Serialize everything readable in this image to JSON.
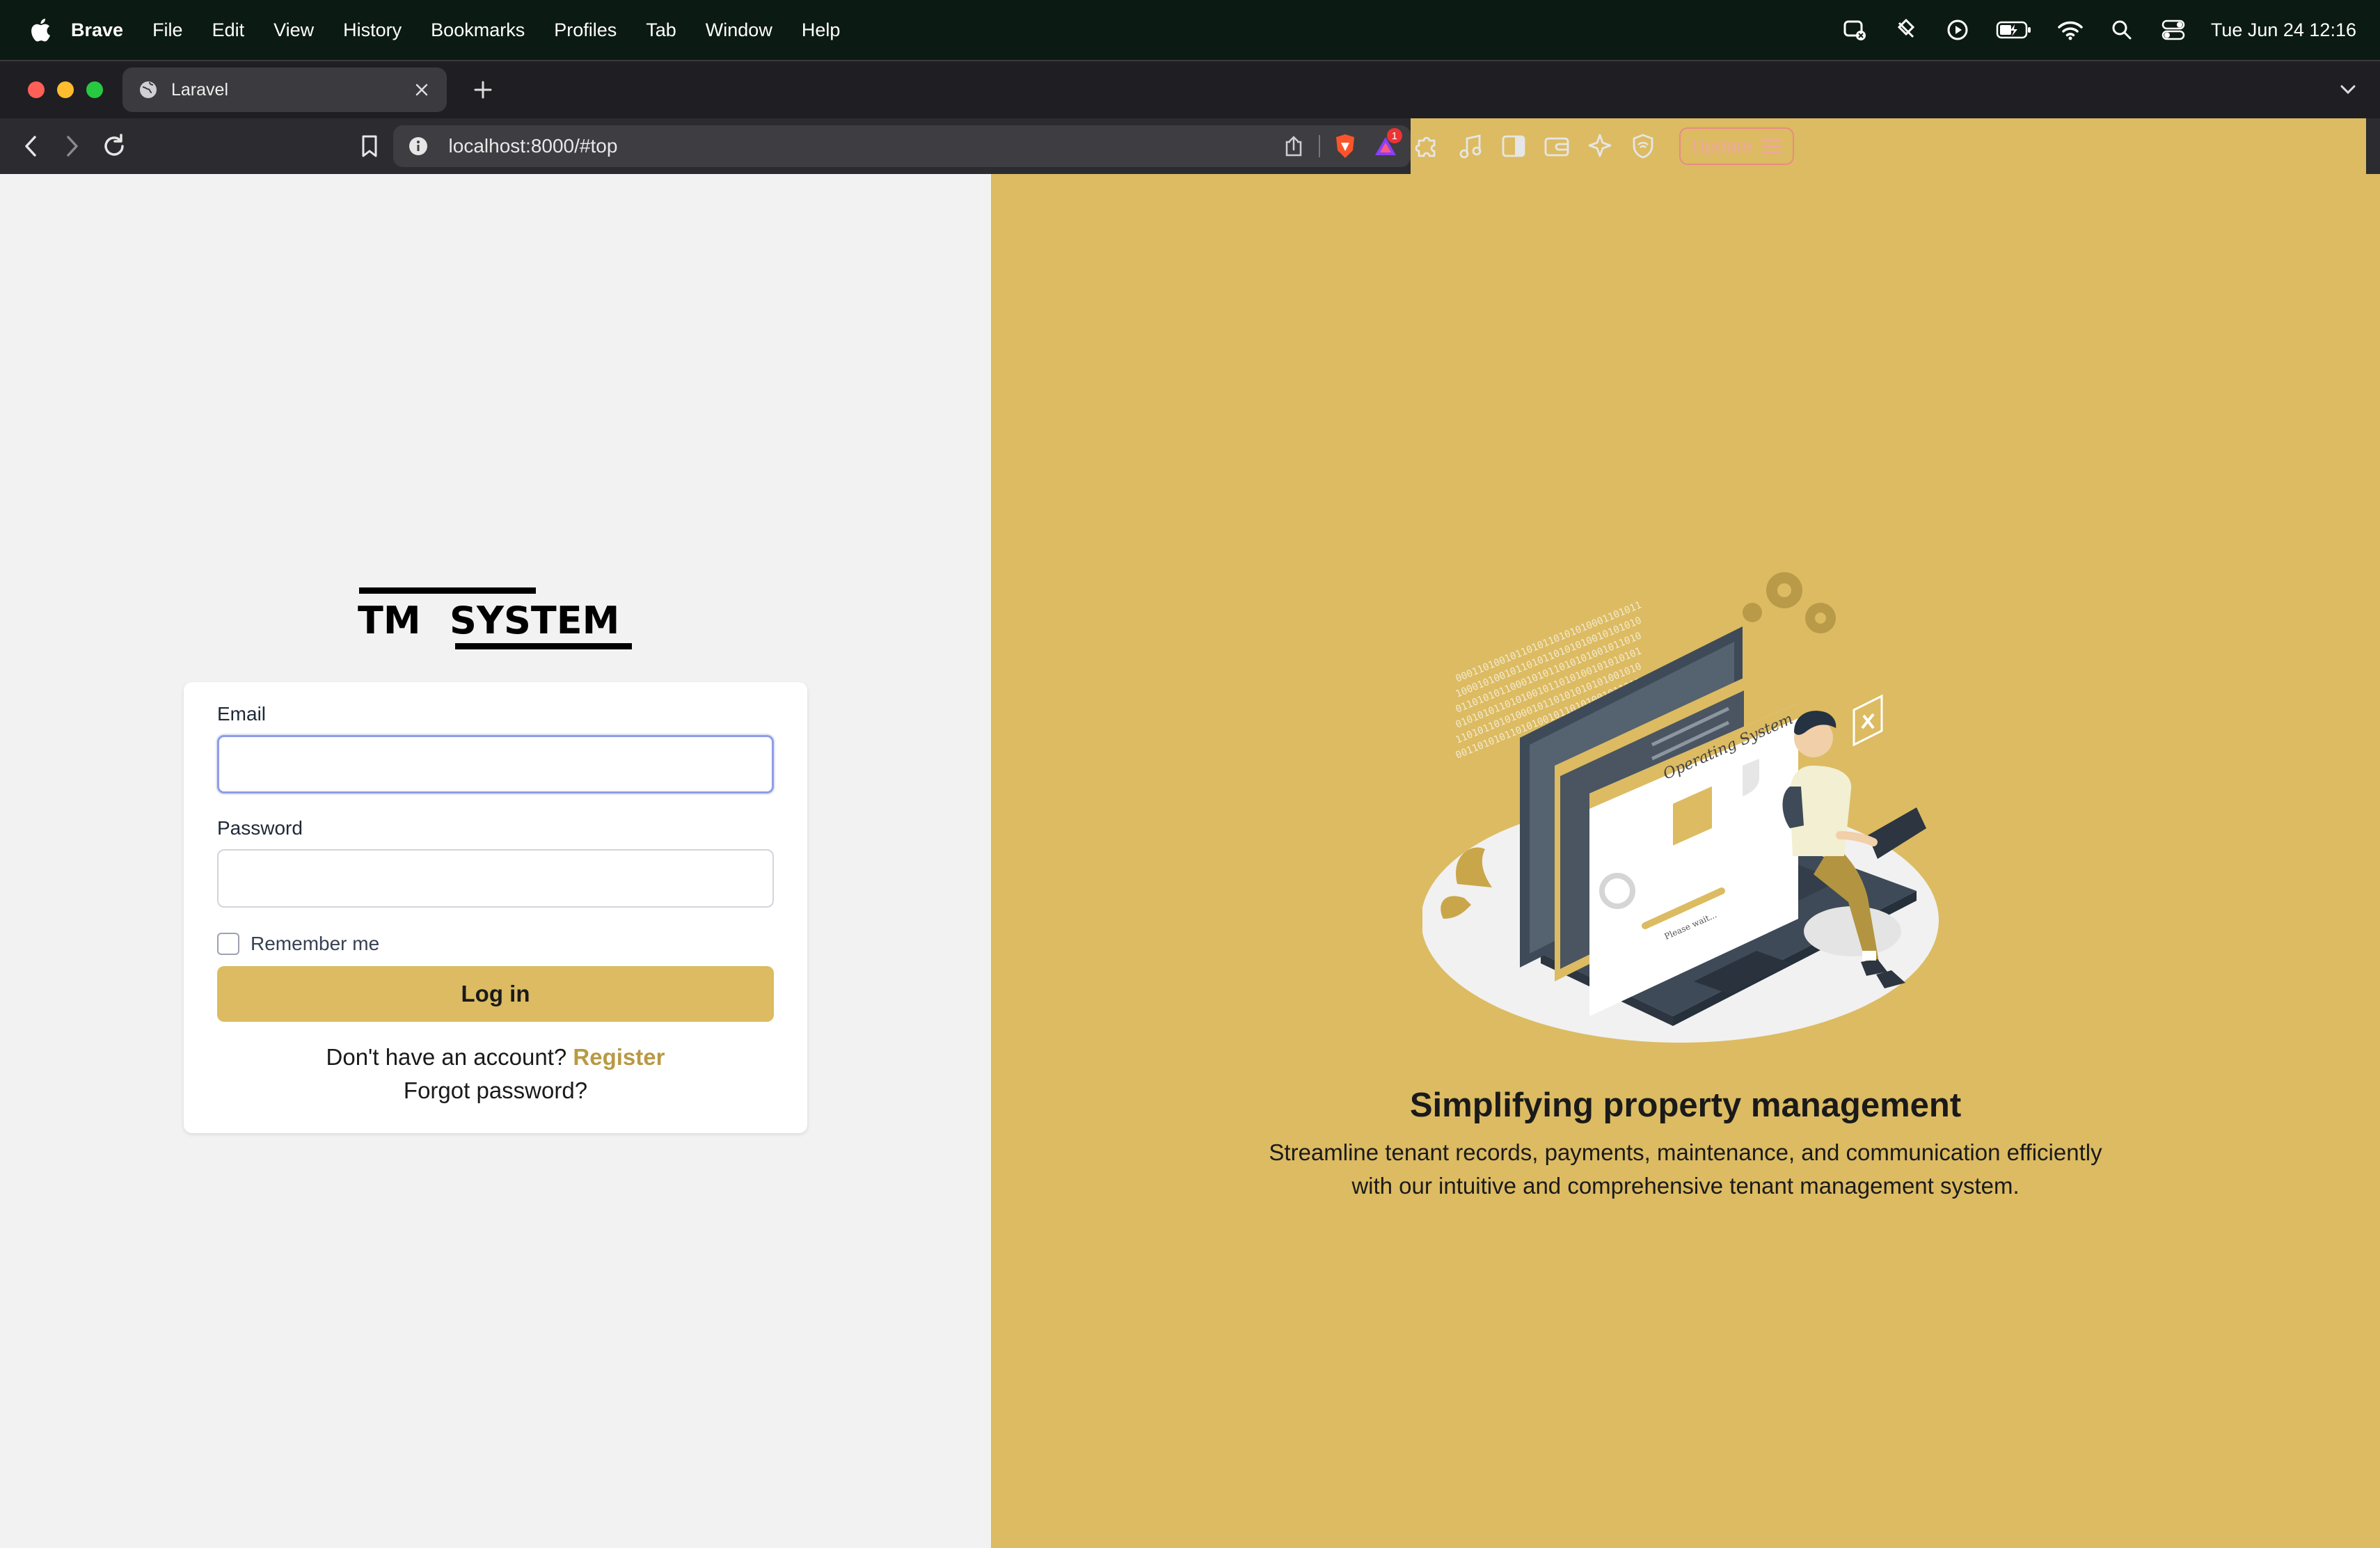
{
  "menubar": {
    "app_name": "Brave",
    "items": [
      "File",
      "Edit",
      "View",
      "History",
      "Bookmarks",
      "Profiles",
      "Tab",
      "Window",
      "Help"
    ],
    "status_icons": [
      "screen-record-icon",
      "brave-vpn-icon",
      "play-icon",
      "battery-icon",
      "wifi-icon",
      "spotlight-search-icon",
      "control-center-icon"
    ],
    "clock": "Tue Jun 24  12:16"
  },
  "browser": {
    "tab_title": "Laravel",
    "url": "localhost:8000/#top",
    "update_label": "Update",
    "rewards_badge": "1",
    "colors": {
      "tabstrip": "#1f1f23",
      "toolbar": "#2b2b30",
      "urlbar": "#3d3d42"
    }
  },
  "login": {
    "logo_text_left": "TM",
    "logo_text_right": "SYSTEM",
    "email_label": "Email",
    "email_value": "",
    "password_label": "Password",
    "password_value": "",
    "remember_label": "Remember me",
    "remember_checked": false,
    "login_button": "Log in",
    "no_account_text": "Don't have an account?",
    "register_link": "Register",
    "forgot_link": "Forgot password?"
  },
  "hero": {
    "title": "Simplifying property management",
    "subtitle_line1": "Streamline tenant records, payments, maintenance, and communication efficiently",
    "subtitle_line2": "with our intuitive and comprehensive tenant management system.",
    "illustration_screen_text": "Operating System",
    "illustration_wait_text": "Please wait...",
    "colors": {
      "accent": "#dcbb62",
      "left_bg": "#f2f2f2"
    }
  }
}
